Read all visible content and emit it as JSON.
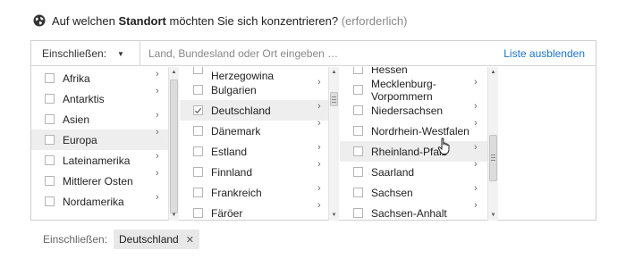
{
  "header": {
    "prefix": "Auf welchen ",
    "strong": "Standort",
    "suffix": " möchten Sie sich konzentrieren? ",
    "required": "(erforderlich)"
  },
  "toolbar": {
    "filter_label": "Einschließen:",
    "search_placeholder": "Land, Bundesland oder Ort eingeben …",
    "hide_link": "Liste ausblenden"
  },
  "columns": {
    "continents": [
      "Afrika",
      "Antarktis",
      "Asien",
      "Europa",
      "Lateinamerika",
      "Mittlerer Osten",
      "Nordamerika"
    ],
    "countries": [
      "Bosnien und Herzegowina",
      "Bulgarien",
      "Deutschland",
      "Dänemark",
      "Estland",
      "Finnland",
      "Frankreich",
      "Färöer"
    ],
    "states": [
      "Hessen",
      "Mecklenburg-Vorpommern",
      "Niedersachsen",
      "Nordrhein-Westfalen",
      "Rheinland-Pfalz",
      "Saarland",
      "Sachsen",
      "Sachsen-Anhalt"
    ]
  },
  "selection": {
    "continent": "Europa",
    "country": "Deutschland",
    "hovered_state": "Rheinland-Pfalz"
  },
  "footer": {
    "label": "Einschließen:",
    "tag": "Deutschland"
  },
  "colors": {
    "link": "#1a73c9",
    "selected_bg": "#eeeeee",
    "border": "#cfcfcf"
  }
}
